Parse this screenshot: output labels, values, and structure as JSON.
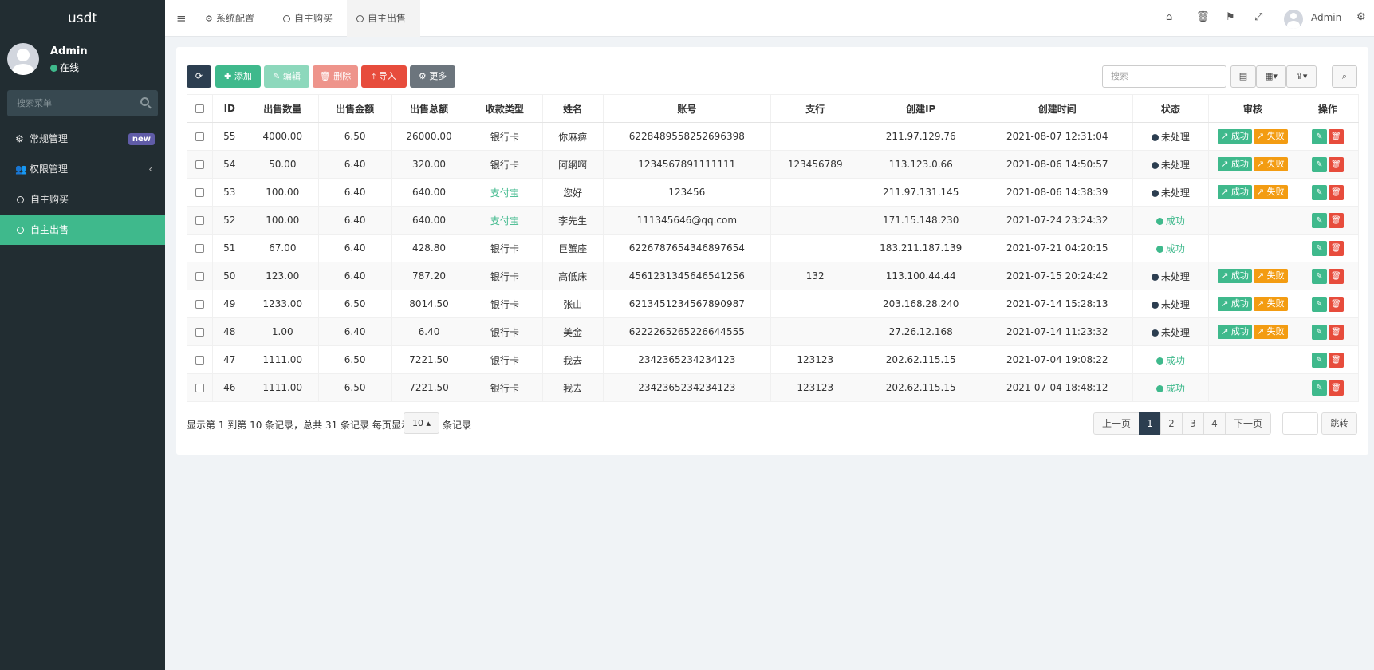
{
  "app": {
    "brand": "usdt"
  },
  "sidebar": {
    "user_name": "Admin",
    "user_status": "在线",
    "search_placeholder": "搜索菜单",
    "items": [
      {
        "label": "常规管理",
        "badge": "new"
      },
      {
        "label": "权限管理",
        "chevron": "‹"
      },
      {
        "label": "自主购买"
      },
      {
        "label": "自主出售"
      }
    ]
  },
  "topbar": {
    "tabs": [
      {
        "label": "系统配置"
      },
      {
        "label": "自主购买"
      },
      {
        "label": "自主出售"
      }
    ],
    "admin_label": "Admin"
  },
  "toolbar": {
    "add": "添加",
    "edit": "编辑",
    "delete": "删除",
    "import": "导入",
    "more": "更多",
    "search_placeholder": "搜索"
  },
  "table": {
    "headers": [
      "ID",
      "出售数量",
      "出售金额",
      "出售总额",
      "收款类型",
      "姓名",
      "账号",
      "支行",
      "创建IP",
      "创建时间",
      "状态",
      "审核",
      "操作"
    ],
    "rows": [
      [
        "55",
        "4000.00",
        "6.50",
        "26000.00",
        "银行卡",
        "你麻痹",
        "6228489558252696398",
        "",
        "211.97.129.76",
        "2021-08-07 12:31:04",
        "未处理"
      ],
      [
        "54",
        "50.00",
        "6.40",
        "320.00",
        "银行卡",
        "阿纲啊",
        "1234567891111111",
        "123456789",
        "113.123.0.66",
        "2021-08-06 14:50:57",
        "未处理"
      ],
      [
        "53",
        "100.00",
        "6.40",
        "640.00",
        "支付宝",
        "您好",
        "123456",
        "",
        "211.97.131.145",
        "2021-08-06 14:38:39",
        "未处理"
      ],
      [
        "52",
        "100.00",
        "6.40",
        "640.00",
        "支付宝",
        "李先生",
        "111345646@qq.com",
        "",
        "171.15.148.230",
        "2021-07-24 23:24:32",
        "成功"
      ],
      [
        "51",
        "67.00",
        "6.40",
        "428.80",
        "银行卡",
        "巨蟹座",
        "6226787654346897654",
        "",
        "183.211.187.139",
        "2021-07-21 04:20:15",
        "成功"
      ],
      [
        "50",
        "123.00",
        "6.40",
        "787.20",
        "银行卡",
        "高低床",
        "4561231345646541256",
        "132",
        "113.100.44.44",
        "2021-07-15 20:24:42",
        "未处理"
      ],
      [
        "49",
        "1233.00",
        "6.50",
        "8014.50",
        "银行卡",
        "张山",
        "6213451234567890987",
        "",
        "203.168.28.240",
        "2021-07-14 15:28:13",
        "未处理"
      ],
      [
        "48",
        "1.00",
        "6.40",
        "6.40",
        "银行卡",
        "美金",
        "6222265265226644555",
        "",
        "27.26.12.168",
        "2021-07-14 11:23:32",
        "未处理"
      ],
      [
        "47",
        "1111.00",
        "6.50",
        "7221.50",
        "银行卡",
        "我去",
        "2342365234234123",
        "123123",
        "202.62.115.15",
        "2021-07-04 19:08:22",
        "成功"
      ],
      [
        "46",
        "1111.00",
        "6.50",
        "7221.50",
        "银行卡",
        "我去",
        "2342365234234123",
        "123123",
        "202.62.115.15",
        "2021-07-04 18:48:12",
        "成功"
      ]
    ],
    "audit_ok": "成功",
    "audit_fail": "失败"
  },
  "footer": {
    "summary": "显示第 1 到第 10 条记录，总共 31 条记录 每页显示",
    "page_size": "10",
    "after": "条记录",
    "prev": "上一页",
    "pages": [
      "1",
      "2",
      "3",
      "4"
    ],
    "next": "下一页",
    "jump": "跳转"
  },
  "colors": {
    "sidebar_bg": "#222d32",
    "accent": "#3fb98c",
    "danger": "#e74c3c",
    "warning": "#f39c12",
    "dark": "#2c3e50"
  }
}
